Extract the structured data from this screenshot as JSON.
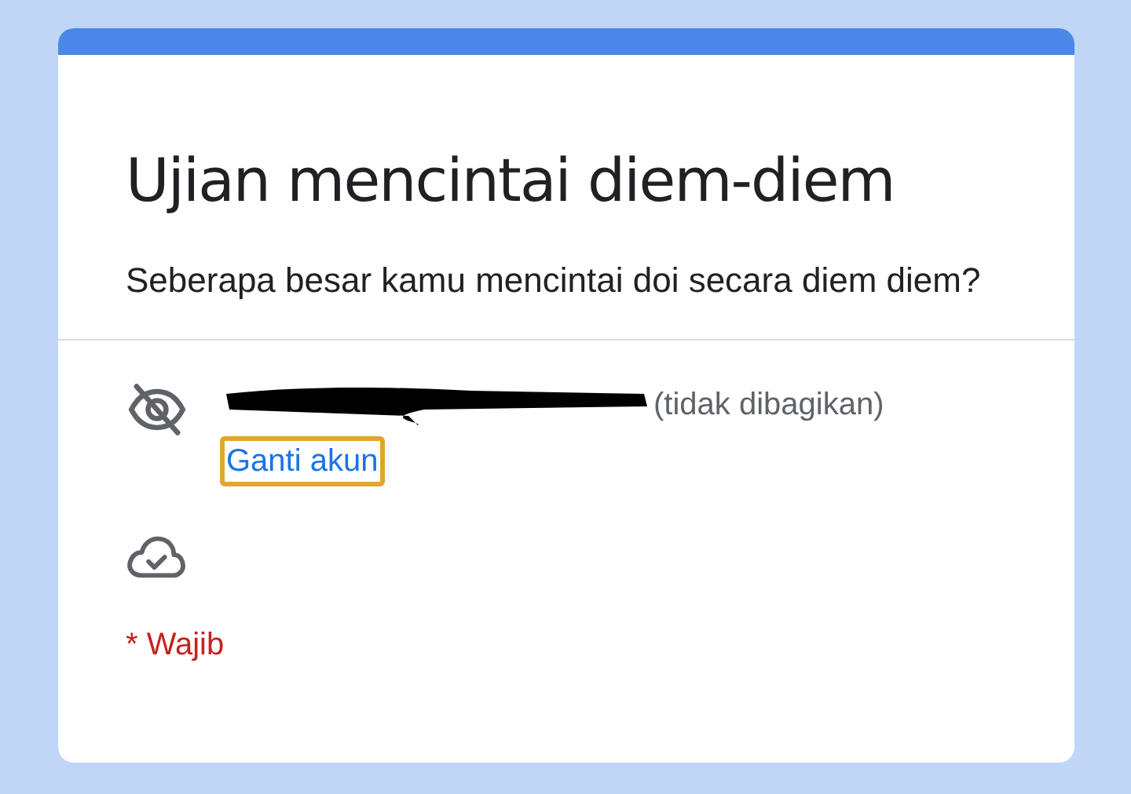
{
  "form": {
    "title": "Ujian mencintai diem-diem",
    "description": "Seberapa besar kamu mencintai doi secara diem diem?",
    "account": {
      "note": "(tidak dibagikan)",
      "switch_link": {
        "label": "Ganti akun",
        "focused": true
      }
    },
    "required_note": "* Wajib"
  }
}
